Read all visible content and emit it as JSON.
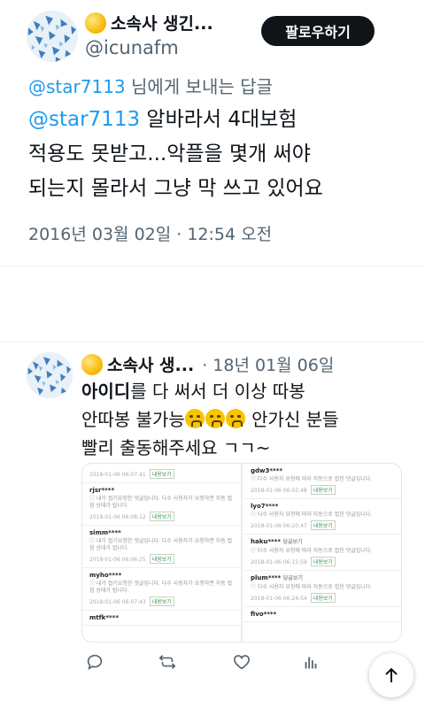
{
  "main_tweet": {
    "display_name": "소속사 생긴...",
    "handle": "@icunafm",
    "follow_label": "팔로우하기",
    "reply_to_handle": "@star7113",
    "reply_to_suffix": " 님에게 보내는 답글",
    "text_mention": "@star7113",
    "text_line1_rest": " 알바라서 4대보험",
    "text_line2": "적용도 못받고...악플을 몇개 써야",
    "text_line3": "되는지 몰라서 그냥 막 쓰고 있어요",
    "timestamp": "2016년 03월 02일 · 12:54 오전"
  },
  "quoted_tweet": {
    "display_name": "소속사 생...",
    "date": "· 18년 01월 06일",
    "line1_bold": "아이디",
    "line1_rest": "를 다 써서 더 이상 따봉",
    "line2_pre": "안따봉 불가능",
    "line2_post": " 안가신 분들",
    "line3": "빨리 출동해주세요 ㄱㄱ~",
    "embed": {
      "left_top_meta": "2018-01-06 06:07:41",
      "left_items": [
        {
          "user": "rjsr****",
          "notice": "ⓘ 내가 접기요청한 댓글입니다. 다수 사용자가 요청하면 자동 접힘 상태가 됩니다.",
          "meta": "2018-01-06 06:08:12"
        },
        {
          "user": "simm****",
          "notice": "ⓘ 내가 접기요청한 댓글입니다. 다수 사용자가 요청하면 자동 접힘 상태가 됩니다.",
          "meta": "2018-01-06 06:06:25"
        },
        {
          "user": "myho****",
          "notice": "ⓘ 내가 접기요청한 댓글입니다. 다수 사용자가 요청하면 자동 접힘 상태가 됩니다.",
          "meta": "2018-01-06 06:07:43"
        },
        {
          "user": "mtfk****",
          "notice": "",
          "meta": ""
        }
      ],
      "right_items": [
        {
          "user": "gdw3****",
          "notice": "ⓘ 다수 사용자 요청에 따라 자동으로 접힌 댓글입니다.",
          "meta": "2018-01-06 06:02:48"
        },
        {
          "user": "lyo7****",
          "notice": "ⓘ 다수 사용자 요청에 따라 자동으로 접힌 댓글입니다.",
          "meta": "2018-01-06 06:20:47"
        },
        {
          "user": "haku****",
          "notice": "ⓘ 다수 사용자 요청에 따라 자동으로 접힌 댓글입니다.",
          "meta": "2018-01-06 06:15:59"
        },
        {
          "user": "plum****",
          "notice": "ⓘ 다수 사용자 요청에 따라 자동으로 접힌 댓글입니다.",
          "meta": "2018-01-06 06:24:54"
        },
        {
          "user": "fivo****",
          "notice": "",
          "meta": ""
        }
      ],
      "show_button_label": "내용보기",
      "reply_tag": "답글보기"
    }
  },
  "icons": {
    "reply": "reply-icon",
    "retweet": "retweet-icon",
    "like": "heart-icon",
    "stats": "bar-chart-icon",
    "scroll_top": "arrow-up-icon"
  },
  "colors": {
    "accent": "#1d9bf0",
    "secondary_text": "#536471",
    "follow_bg": "#0f1419"
  }
}
